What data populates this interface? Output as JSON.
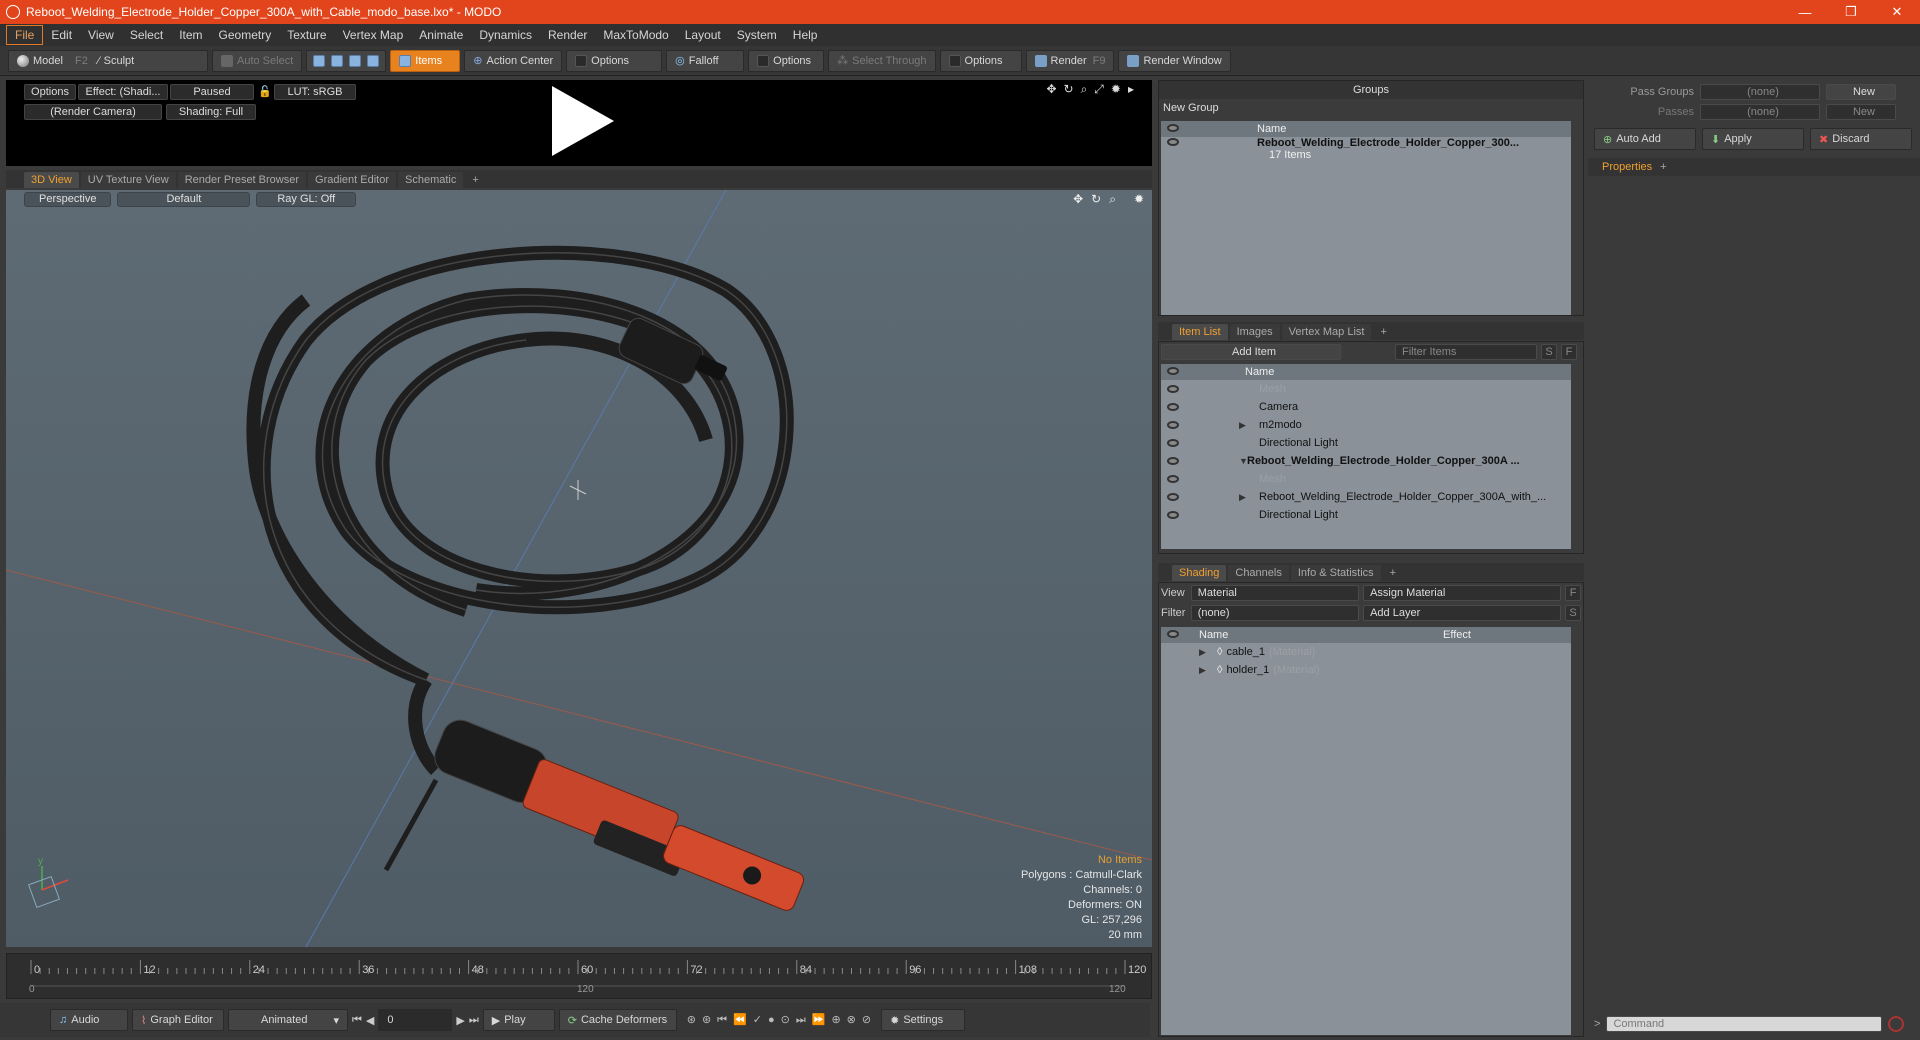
{
  "window": {
    "title": "Reboot_Welding_Electrode_Holder_Copper_300A_with_Cable_modo_base.lxo* - MODO",
    "controls": [
      "—",
      "❐",
      "✕"
    ]
  },
  "menu": [
    "File",
    "Edit",
    "View",
    "Select",
    "Item",
    "Geometry",
    "Texture",
    "Vertex Map",
    "Animate",
    "Dynamics",
    "Render",
    "MaxToModo",
    "Layout",
    "System",
    "Help"
  ],
  "toolbar": {
    "model": "Model",
    "model_key": "F2",
    "sculpt": "Sculpt",
    "auto_select": "Auto Select",
    "items": "Items",
    "action_center": "Action Center",
    "options1": "Options",
    "falloff": "Falloff",
    "options2": "Options",
    "select_through": "Select Through",
    "options3": "Options",
    "render": "Render",
    "render_key": "F9",
    "render_window": "Render Window"
  },
  "preview": {
    "options": "Options",
    "effect": "Effect: (Shadi...",
    "paused": "Paused",
    "lut": "LUT: sRGB",
    "camera": "(Render Camera)",
    "shading": "Shading: Full"
  },
  "viewport_tabs": [
    "3D View",
    "UV Texture View",
    "Render Preset Browser",
    "Gradient Editor",
    "Schematic",
    "+"
  ],
  "viewport": {
    "perspective": "Perspective",
    "default": "Default",
    "raygl": "Ray GL: Off",
    "stats": {
      "no_items": "No Items",
      "polygons": "Polygons : Catmull-Clark",
      "channels": "Channels: 0",
      "deformers": "Deformers: ON",
      "gl": "GL: 257,296",
      "unit": "20 mm"
    }
  },
  "timeline": {
    "ticks": [
      "0",
      "12",
      "24",
      "36",
      "48",
      "60",
      "72",
      "84",
      "96",
      "108",
      "120"
    ],
    "sub_start": "0",
    "sub_mid": "120",
    "sub_end": "120"
  },
  "transport": {
    "audio": "Audio",
    "graph_editor": "Graph Editor",
    "animated": "Animated",
    "frame": "0",
    "play": "Play",
    "cache": "Cache Deformers",
    "settings": "Settings"
  },
  "groups": {
    "title": "Groups",
    "new_group": "New Group",
    "col_name": "Name",
    "item_name": "Reboot_Welding_Electrode_Holder_Copper_300...",
    "item_count": "17 Items"
  },
  "item_list": {
    "tabs": [
      "Item List",
      "Images",
      "Vertex Map List",
      "+"
    ],
    "add_item": "Add Item",
    "filter": "Filter Items",
    "s": "S",
    "f": "F",
    "col_name": "Name",
    "rows": [
      {
        "label": "Mesh",
        "dim": true,
        "indent": 1
      },
      {
        "label": "Camera",
        "dim": false,
        "indent": 1
      },
      {
        "label": "m2modo",
        "dim": false,
        "indent": 1,
        "expand": "▶"
      },
      {
        "label": "Directional Light",
        "dim": false,
        "indent": 1
      },
      {
        "label": "Reboot_Welding_Electrode_Holder_Copper_300A ...",
        "dim": false,
        "bold": true,
        "indent": 0,
        "expand": "▼"
      },
      {
        "label": "Mesh",
        "dim": true,
        "indent": 1
      },
      {
        "label": "Reboot_Welding_Electrode_Holder_Copper_300A_with_...",
        "dim": false,
        "indent": 1,
        "expand": "▶"
      },
      {
        "label": "Directional Light",
        "dim": false,
        "indent": 1
      }
    ]
  },
  "shading": {
    "tabs": [
      "Shading",
      "Channels",
      "Info & Statistics",
      "+"
    ],
    "view_label": "View",
    "view_value": "Material",
    "assign": "Assign Material",
    "f": "F",
    "filter_label": "Filter",
    "filter_value": "(none)",
    "add_layer": "Add Layer",
    "s": "S",
    "col_name": "Name",
    "col_effect": "Effect",
    "rows": [
      {
        "name": "cable_1",
        "type": "(Material)"
      },
      {
        "name": "holder_1",
        "type": "(Material)"
      }
    ]
  },
  "right": {
    "pass_groups": "Pass Groups",
    "pass_groups_val": "(none)",
    "new1": "New",
    "passes": "Passes",
    "passes_val": "(none)",
    "new2": "New",
    "auto_add": "Auto Add",
    "apply": "Apply",
    "discard": "Discard",
    "properties": "Properties",
    "command": "Command"
  },
  "colors": {
    "accent": "#e2451c",
    "active": "#e8821e",
    "selected_tab": "#f0a030"
  }
}
